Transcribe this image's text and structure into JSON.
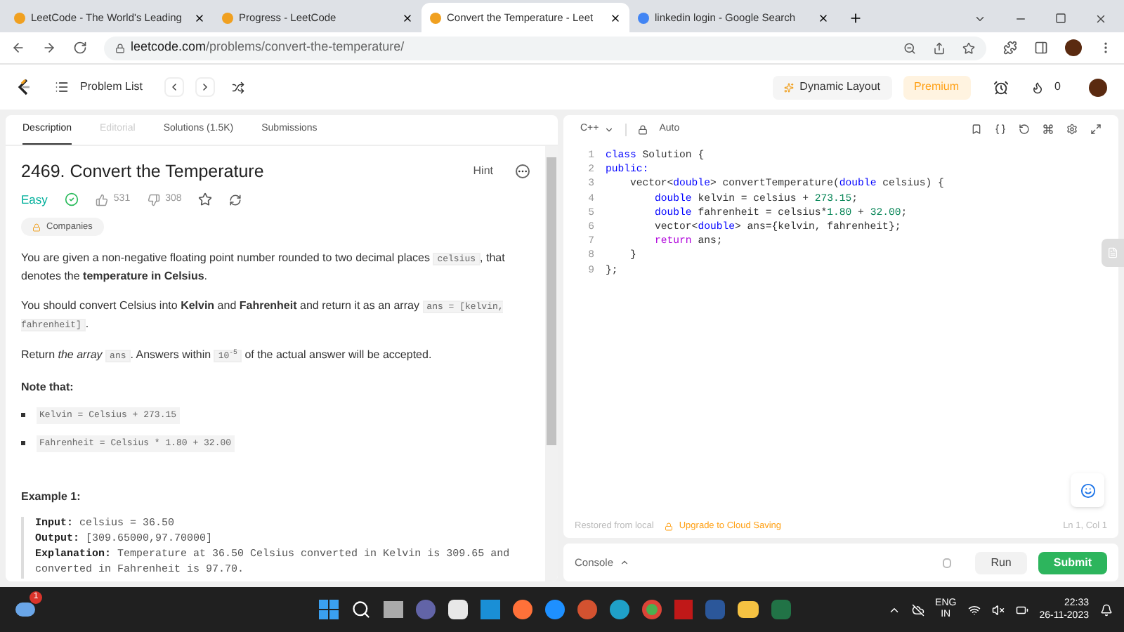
{
  "browser": {
    "tabs": [
      {
        "title": "LeetCode - The World's Leading",
        "selected": false
      },
      {
        "title": "Progress - LeetCode",
        "selected": false
      },
      {
        "title": "Convert the Temperature - Leet",
        "selected": true
      },
      {
        "title": "linkedin login - Google Search",
        "selected": false
      }
    ],
    "url_domain": "leetcode.com",
    "url_path": "/problems/convert-the-temperature/"
  },
  "nav": {
    "problem_list": "Problem List",
    "dynamic_layout": "Dynamic Layout",
    "premium": "Premium",
    "streak": "0"
  },
  "left_tabs": [
    {
      "label": "Description",
      "selected": true,
      "disabled": false
    },
    {
      "label": "Editorial",
      "selected": false,
      "disabled": true
    },
    {
      "label": "Solutions (1.5K)",
      "selected": false,
      "disabled": false
    },
    {
      "label": "Submissions",
      "selected": false,
      "disabled": false
    }
  ],
  "problem": {
    "title": "2469. Convert the Temperature",
    "hint": "Hint",
    "difficulty": "Easy",
    "likes": "531",
    "dislikes": "308",
    "companies": "Companies",
    "paragraphs": [
      [
        {
          "kind": "text",
          "text": "You are given a non-negative floating point number rounded to two decimal places "
        },
        {
          "kind": "code",
          "text": "celsius"
        },
        {
          "kind": "text",
          "text": ", that denotes the **temperature in Celsius**."
        }
      ],
      [
        {
          "kind": "text",
          "text": "You should convert Celsius into **Kelvin** and **Fahrenheit** and return it as an array "
        },
        {
          "kind": "code",
          "text": "ans = [kelvin, fahrenheit]"
        },
        {
          "kind": "text",
          "text": "."
        }
      ],
      [
        {
          "kind": "text",
          "text": "Return *the array* "
        },
        {
          "kind": "code",
          "text": "ans"
        },
        {
          "kind": "text",
          "text": ". Answers within "
        },
        {
          "kind": "code",
          "text": "10$^{-5}$"
        },
        {
          "kind": "text",
          "text": " of the actual answer will be accepted."
        }
      ]
    ],
    "note_title": "Note that:",
    "notes": [
      "Kelvin = Celsius + 273.15",
      "Fahrenheit = Celsius * 1.80 + 32.00"
    ],
    "example_title": "Example 1:",
    "example": [
      {
        "label": "Input:",
        "text": "celsius = 36.50"
      },
      {
        "label": "Output:",
        "text": "[309.65000,97.70000]"
      },
      {
        "label": "Explanation:",
        "text": "Temperature at 36.50 Celsius converted in Kelvin is 309.65 and converted in Fahrenheit is 97.70."
      }
    ]
  },
  "editor": {
    "language": "C++",
    "mode": "Auto",
    "lines": [
      [
        {
          "kind": "keyword",
          "text": "class"
        },
        {
          "kind": "plain",
          "text": " Solution {"
        }
      ],
      [
        {
          "kind": "keyword",
          "text": "public:"
        }
      ],
      [
        {
          "kind": "plain",
          "text": "    vector<"
        },
        {
          "kind": "keyword",
          "text": "double"
        },
        {
          "kind": "plain",
          "text": "> convertTemperature("
        },
        {
          "kind": "keyword",
          "text": "double"
        },
        {
          "kind": "plain",
          "text": " celsius) {"
        }
      ],
      [
        {
          "kind": "keyword",
          "text": "        double"
        },
        {
          "kind": "plain",
          "text": " kelvin = celsius + "
        },
        {
          "kind": "number",
          "text": "273.15"
        },
        {
          "kind": "plain",
          "text": ";"
        }
      ],
      [
        {
          "kind": "keyword",
          "text": "        double"
        },
        {
          "kind": "plain",
          "text": " fahrenheit = celsius*"
        },
        {
          "kind": "number",
          "text": "1.80"
        },
        {
          "kind": "plain",
          "text": " + "
        },
        {
          "kind": "number",
          "text": "32.00"
        },
        {
          "kind": "plain",
          "text": ";"
        }
      ],
      [
        {
          "kind": "plain",
          "text": "        vector<"
        },
        {
          "kind": "keyword",
          "text": "double"
        },
        {
          "kind": "plain",
          "text": "> ans={kelvin, fahrenheit};"
        }
      ],
      [
        {
          "kind": "control",
          "text": "        return"
        },
        {
          "kind": "plain",
          "text": " ans;"
        }
      ],
      [
        {
          "kind": "plain",
          "text": "    }"
        }
      ],
      [
        {
          "kind": "plain",
          "text": "};"
        }
      ]
    ],
    "line_numbers": [
      "1",
      "2",
      "3",
      "4",
      "5",
      "6",
      "7",
      "8",
      "9"
    ],
    "restored": "Restored from local",
    "upgrade": "Upgrade to Cloud Saving",
    "cursor": "Ln 1, Col 1"
  },
  "console": {
    "label": "Console",
    "run": "Run",
    "submit": "Submit"
  },
  "taskbar": {
    "badge": "1",
    "lang_top": "ENG",
    "lang_bottom": "IN",
    "time": "22:33",
    "date": "26-11-2023"
  }
}
